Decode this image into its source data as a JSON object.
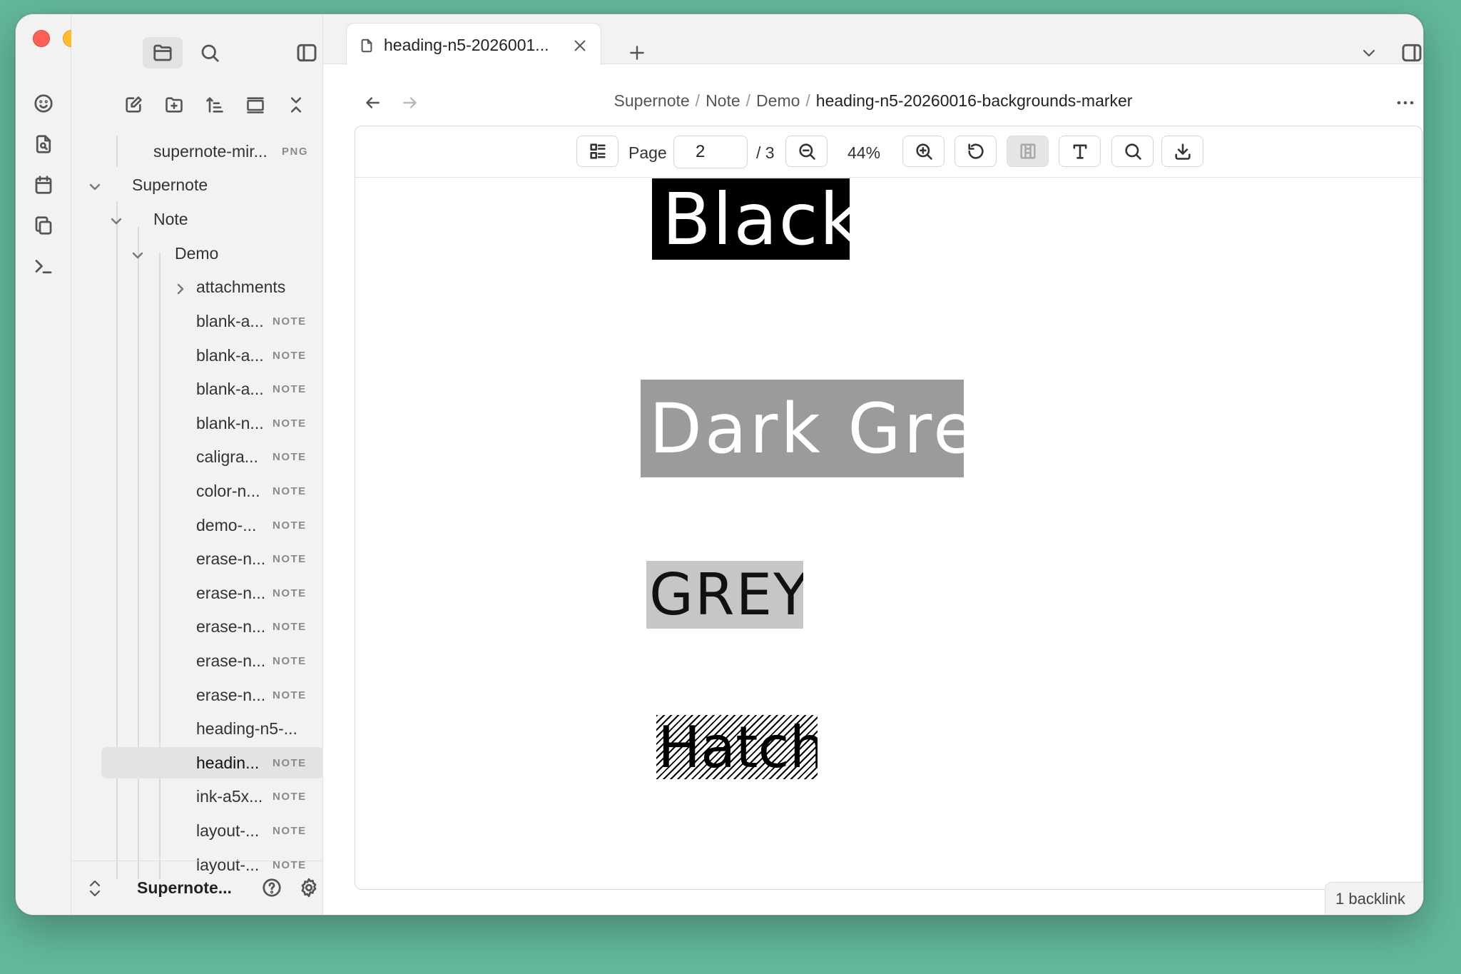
{
  "window": {
    "theme_bg": "#63b99a"
  },
  "tab": {
    "title": "heading-n5-2026001..."
  },
  "breadcrumb": {
    "items": [
      "Supernote",
      "Note",
      "Demo"
    ],
    "current": "heading-n5-20260016-backgrounds-marker"
  },
  "sidebar": {
    "top_file": {
      "label": "supernote-mir...",
      "badge": "PNG"
    },
    "folders": [
      {
        "label": "Supernote"
      },
      {
        "label": "Note"
      },
      {
        "label": "Demo"
      },
      {
        "label": "attachments"
      }
    ],
    "files": [
      {
        "label": "blank-a...",
        "badge": "NOTE"
      },
      {
        "label": "blank-a...",
        "badge": "NOTE"
      },
      {
        "label": "blank-a...",
        "badge": "NOTE"
      },
      {
        "label": "blank-n...",
        "badge": "NOTE"
      },
      {
        "label": "caligra...",
        "badge": "NOTE"
      },
      {
        "label": "color-n...",
        "badge": "NOTE"
      },
      {
        "label": "demo-...",
        "badge": "NOTE"
      },
      {
        "label": "erase-n...",
        "badge": "NOTE"
      },
      {
        "label": "erase-n...",
        "badge": "NOTE"
      },
      {
        "label": "erase-n...",
        "badge": "NOTE"
      },
      {
        "label": "erase-n...",
        "badge": "NOTE"
      },
      {
        "label": "erase-n...",
        "badge": "NOTE"
      },
      {
        "label": "heading-n5-...",
        "badge": ""
      },
      {
        "label": "headin...",
        "badge": "NOTE"
      },
      {
        "label": "ink-a5x...",
        "badge": "NOTE"
      },
      {
        "label": "layout-...",
        "badge": "NOTE"
      },
      {
        "label": "layout-...",
        "badge": "NOTE"
      }
    ],
    "vault_name": "Supernote..."
  },
  "viewer": {
    "page_label": "Page",
    "page_value": "2",
    "page_total": "/ 3",
    "zoom": "44%"
  },
  "ink_samples": [
    {
      "text": "Black",
      "background": "#000000",
      "ink": "#ffffff"
    },
    {
      "text": "Dark  Grey",
      "background": "#9b9b9b",
      "ink": "#ffffff"
    },
    {
      "text": "GREY",
      "background": "#c6c6c6",
      "ink": "#111111"
    },
    {
      "text": "Hatch",
      "background": "hatch",
      "ink": "#000000"
    }
  ],
  "status": {
    "backlinks": "1 backlink"
  }
}
